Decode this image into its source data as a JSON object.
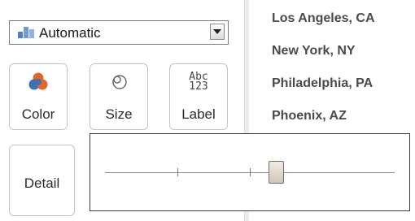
{
  "marks": {
    "type_select": {
      "value": "Automatic",
      "icon": "bar-chart-icon"
    },
    "buttons": [
      {
        "label": "Color",
        "icon": "color-palette-icon"
      },
      {
        "label": "Size",
        "icon": "size-icon"
      },
      {
        "label": "Label",
        "icon": "label-abc-icon",
        "icon_text_top": "Abc",
        "icon_text_bottom": "123"
      },
      {
        "label": "Detail"
      }
    ]
  },
  "rows": {
    "items": [
      "Los Angeles, CA",
      "New York, NY",
      "Philadelphia, PA",
      "Phoenix, AZ"
    ]
  },
  "size_slider": {
    "value_fraction": 0.59
  },
  "colors": {
    "color_blue": "#3d6fb5",
    "color_orange": "#e0662a",
    "city_text": "#4a4a4a",
    "popup_border": "#3a3a3a"
  }
}
